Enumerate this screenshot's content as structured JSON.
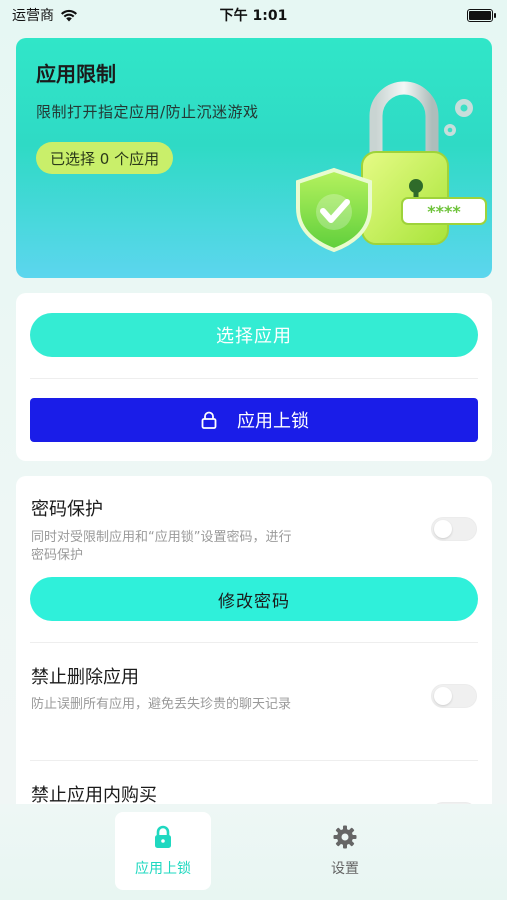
{
  "status_bar": {
    "carrier": "运营商",
    "time": "下午 1:01"
  },
  "hero": {
    "title": "应用限制",
    "subtitle": "限制打开指定应用/防止沉迷游戏",
    "selected_badge": "已选择 0 个应用",
    "illustration_password_text": "****"
  },
  "actions": {
    "select_app_label": "选择应用",
    "lock_app_label": "应用上锁"
  },
  "settings": [
    {
      "title": "密码保护",
      "description": "同时对受限制应用和“应用锁”设置密码，进行密码保护",
      "enabled": false,
      "button_label": "修改密码"
    },
    {
      "title": "禁止删除应用",
      "description": "防止误删所有应用，避免丢失珍贵的聊天记录",
      "enabled": false
    },
    {
      "title": "禁止应用内购买",
      "enabled": false
    }
  ],
  "tabs": [
    {
      "label": "应用上锁",
      "icon": "lock-icon",
      "active": true
    },
    {
      "label": "设置",
      "icon": "gear-icon",
      "active": false
    }
  ],
  "colors": {
    "accent": "#34ecd3",
    "primary_button": "#1a1de8",
    "badge": "#c9ef6a"
  }
}
